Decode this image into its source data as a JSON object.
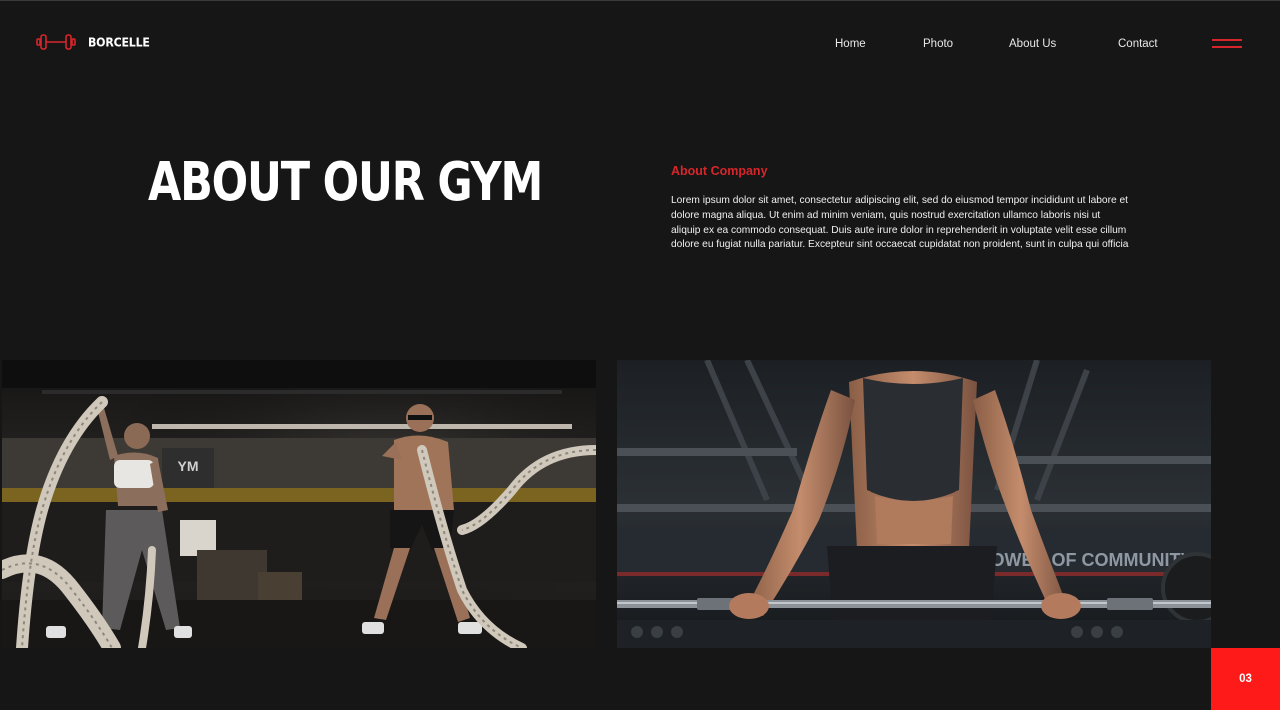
{
  "header": {
    "brand": "BORCELLE",
    "nav": {
      "home": "Home",
      "photo": "Photo",
      "about": "About Us",
      "contact": "Contact"
    }
  },
  "hero": {
    "title": "ABOUT OUR GYM",
    "section_label": "About Company",
    "body": "Lorem ipsum dolor sit amet, consectetur adipiscing elit, sed do eiusmod tempor incididunt ut labore et dolore magna aliqua. Ut enim ad minim veniam, quis nostrud exercitation ullamco laboris nisi ut aliquip ex ea commodo consequat. Duis aute irure dolor in reprehenderit in voluptate velit esse cillum dolore eu fugiat nulla pariatur. Excepteur sint occaecat cupidatat non proident, sunt in culpa qui officia"
  },
  "photos": {
    "left_wall_sign": "YM",
    "right_wall_sign": "THE POWER OF COMMUNITY"
  },
  "page": {
    "number": "03"
  },
  "icons": {
    "logo": "dumbbell-icon",
    "menu": "hamburger-menu-icon"
  },
  "colors": {
    "background": "#161616",
    "accent": "#d7262b",
    "badge": "#ff1a1a",
    "text": "#ffffff"
  }
}
